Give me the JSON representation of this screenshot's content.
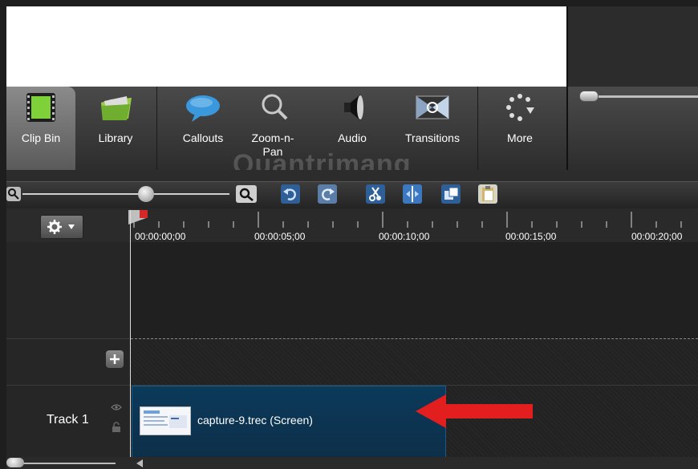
{
  "tabs": [
    {
      "id": "clip-bin",
      "label": "Clip Bin",
      "icon": "film-strip-icon"
    },
    {
      "id": "library",
      "label": "Library",
      "icon": "folder-icon"
    },
    {
      "id": "callouts",
      "label": "Callouts",
      "icon": "speech-bubble-icon"
    },
    {
      "id": "zoom-n-pan",
      "label": "Zoom-n-Pan",
      "icon": "magnifier-icon"
    },
    {
      "id": "audio",
      "label": "Audio",
      "icon": "speaker-icon"
    },
    {
      "id": "transitions",
      "label": "Transitions",
      "icon": "transition-icon"
    },
    {
      "id": "more",
      "label": "More",
      "icon": "more-dots-icon"
    }
  ],
  "ruler": {
    "times": [
      "00:00:00;00",
      "00:00:05;00",
      "00:00:10;00",
      "00:00:15;00",
      "00:00:20;00"
    ]
  },
  "timeline": {
    "track_name": "Track 1",
    "clip_name": "capture-9.trec (Screen)"
  },
  "watermark": "Quantrimang",
  "colors": {
    "clip_bg": "#0d3a5a",
    "arrow": "#e31e1e",
    "accent_blue": "#2b7fd6"
  }
}
